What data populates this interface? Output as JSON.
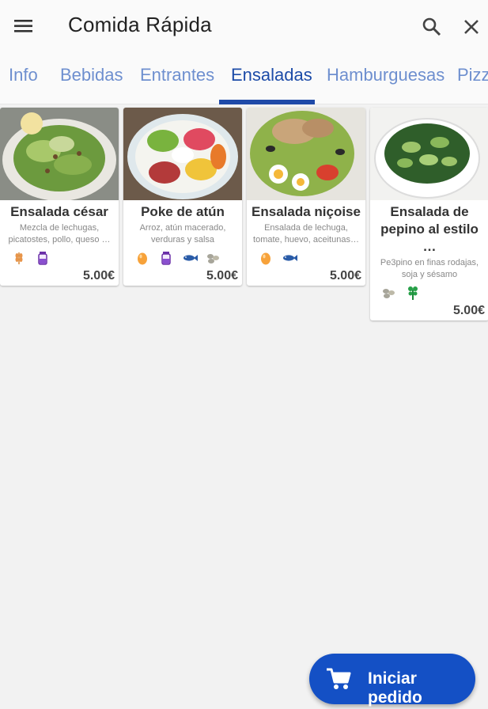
{
  "header": {
    "title": "Comida Rápida",
    "menu_icon": "menu-icon",
    "search_icon": "search-icon",
    "close_icon": "close-icon"
  },
  "tabs": [
    {
      "label": "Info"
    },
    {
      "label": "Bebidas"
    },
    {
      "label": "Entrantes"
    },
    {
      "label": "Ensaladas",
      "active": true
    },
    {
      "label": "Hamburguesas"
    },
    {
      "label": "Pizzas"
    }
  ],
  "cards": [
    {
      "title": "Ensalada césar",
      "description": "Mezcla de lechugas, picatostes, pollo, queso …",
      "allergens": [
        "gluten-icon",
        "milk-icon"
      ],
      "price": "5.00€"
    },
    {
      "title": "Poke de atún",
      "description": "Arroz, atún macerado, verduras y salsa",
      "allergens": [
        "egg-icon",
        "milk-icon",
        "fish-icon",
        "soy-icon"
      ],
      "price": "5.00€"
    },
    {
      "title": "Ensalada niçoise",
      "description": "Ensalada de lechuga, tomate, huevo, aceitunas…",
      "allergens": [
        "egg-icon",
        "fish-icon"
      ],
      "price": "5.00€"
    },
    {
      "title": "Ensalada de pepino al estilo …",
      "description": "Pe3pino en finas rodajas, soja y sésamo",
      "allergens": [
        "soy-icon",
        "celery-icon"
      ],
      "price": "5.00€"
    }
  ],
  "fab": {
    "label": "Iniciar pedido",
    "icon": "cart-icon"
  },
  "colors": {
    "accent": "#1f4aa8",
    "tab_inactive": "#6e8fcf",
    "fab": "#1450c5"
  }
}
